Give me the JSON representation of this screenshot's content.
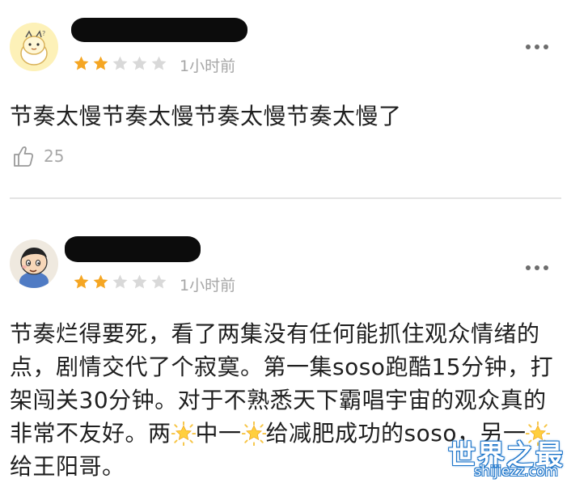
{
  "comments": [
    {
      "time": "1小时前",
      "rating": 2,
      "max_rating": 5,
      "text": "节奏太慢节奏太慢节奏太慢节奏太慢了",
      "likes": "25"
    },
    {
      "time": "1小时前",
      "rating": 2,
      "max_rating": 5,
      "text_parts": [
        "节奏烂得要死，看了两集没有任何能抓住观众情绪的点，剧情交代了个寂寞。第一集soso跑酷15分钟，打架闯关30分钟。对于不熟悉天下霸唱宇宙的观众真的非常不友好。两",
        "中一",
        "给减肥成功的soso，另一",
        "给王阳哥。"
      ]
    }
  ],
  "watermark": {
    "title": "世界之最",
    "url": "shijiezz.com"
  },
  "colors": {
    "star_filled": "#f5a623",
    "star_empty": "#d9d9d9",
    "meta_text": "#a6a6a6",
    "divider": "#e3e3e3",
    "watermark_blue": "#1a73c9"
  },
  "icons": {
    "like": "thumbs-up-icon",
    "more": "more-dots-icon",
    "star": "star-icon",
    "emoji": "glowing-star-emoji"
  }
}
